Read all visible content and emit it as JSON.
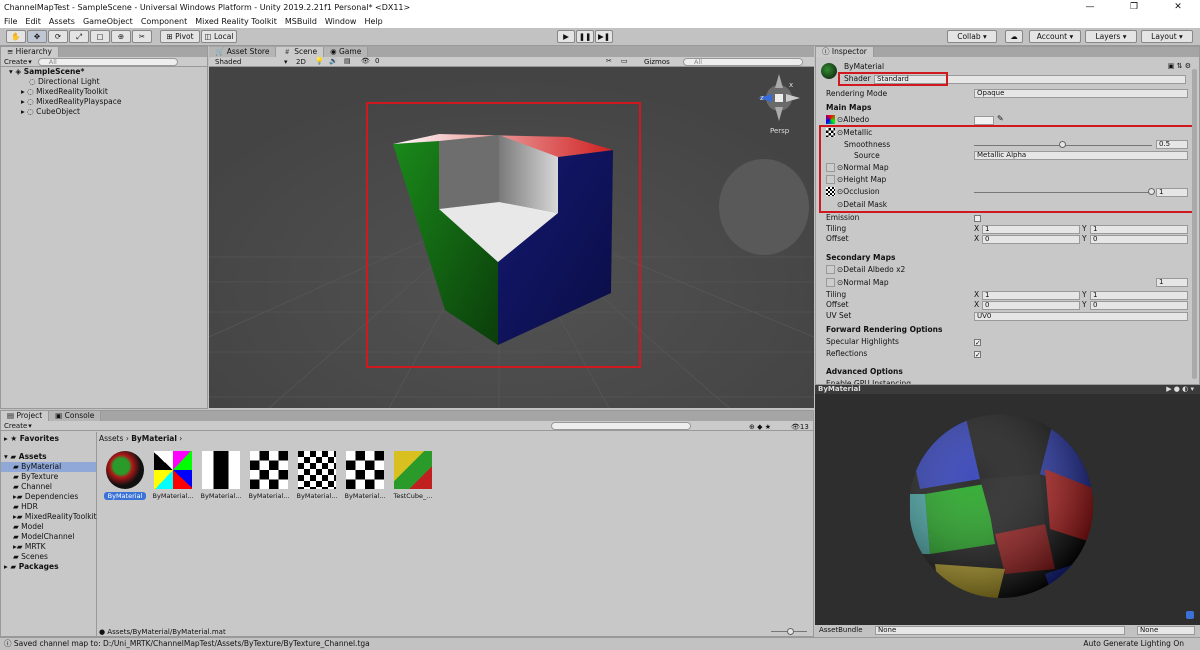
{
  "window": {
    "title": "ChannelMapTest - SampleScene - Universal Windows Platform - Unity 2019.2.21f1 Personal* <DX11>"
  },
  "menu": [
    "File",
    "Edit",
    "Assets",
    "GameObject",
    "Component",
    "Mixed Reality Toolkit",
    "MSBuild",
    "Window",
    "Help"
  ],
  "toolbar": {
    "pivot": "Pivot",
    "local": "Local",
    "collab": "Collab",
    "account": "Account",
    "layers": "Layers",
    "layout": "Layout"
  },
  "hierarchy": {
    "tab": "Hierarchy",
    "create": "Create",
    "search_placeholder": "All",
    "scene": "SampleScene*",
    "items": [
      "Directional Light",
      "MixedRealityToolkit",
      "MixedRealityPlayspace",
      "CubeObject"
    ]
  },
  "scene_view": {
    "tabs": [
      "Asset Store",
      "Scene",
      "Game"
    ],
    "shading": "Shaded",
    "mode2d": "2D",
    "gizmos": "Gizmos",
    "search_placeholder": "All",
    "persp": "Persp",
    "axis_x": "x",
    "axis_z": "z",
    "visible_count": "0"
  },
  "inspector": {
    "tab": "Inspector",
    "material_name": "ByMaterial",
    "shader_label": "Shader",
    "shader_value": "Standard",
    "rendering_mode_label": "Rendering Mode",
    "rendering_mode_value": "Opaque",
    "main_maps": "Main Maps",
    "albedo": "Albedo",
    "metallic": "Metallic",
    "smoothness": "Smoothness",
    "smoothness_value": "0.5",
    "smoothness_level": 0.5,
    "source": "Source",
    "source_value": "Metallic Alpha",
    "normal_map": "Normal Map",
    "height_map": "Height Map",
    "occlusion": "Occlusion",
    "occlusion_value": "1",
    "occlusion_level": 1.0,
    "detail_mask": "Detail Mask",
    "emission": "Emission",
    "tiling": "Tiling",
    "offset": "Offset",
    "tiling_x": "1",
    "tiling_y": "1",
    "offset_x": "0",
    "offset_y": "0",
    "secondary_maps": "Secondary Maps",
    "detail_albedo": "Detail Albedo x2",
    "normal_map2": "Normal Map",
    "normal_map2_value": "1",
    "tiling2_x": "1",
    "tiling2_y": "1",
    "offset2_x": "0",
    "offset2_y": "0",
    "uv_set": "UV Set",
    "uv_set_value": "UV0",
    "forward_options": "Forward Rendering Options",
    "specular_highlights": "Specular Highlights",
    "reflections": "Reflections",
    "advanced_options": "Advanced Options",
    "gpu_instancing": "Enable GPU Instancing",
    "axis_x": "X",
    "axis_y": "Y"
  },
  "preview": {
    "title": "ByMaterial",
    "asset_bundle_label": "AssetBundle",
    "asset_bundle_value": "None",
    "variant_value": "None"
  },
  "project": {
    "tabs": [
      "Project",
      "Console"
    ],
    "create": "Create",
    "favorites": "Favorites",
    "assets": "Assets",
    "folders": [
      "ByMaterial",
      "ByTexture",
      "Channel",
      "Dependencies",
      "HDR",
      "MixedRealityToolkit",
      "Model",
      "ModelChannel",
      "MRTK",
      "Scenes"
    ],
    "packages": "Packages",
    "breadcrumb": [
      "Assets",
      "ByMaterial"
    ],
    "count": "13",
    "asset_items": [
      "ByMaterial",
      "ByMaterial...",
      "ByMaterial...",
      "ByMaterial...",
      "ByMaterial...",
      "ByMaterial...",
      "TestCube_..."
    ],
    "selected_path": "Assets/ByMaterial/ByMaterial.mat"
  },
  "status": {
    "message": "Saved channel map to: D:/Uni_MRTK/ChannelMapTest/Assets/ByTexture/ByTexture_Channel.tga",
    "right": "Auto Generate Lighting On"
  },
  "colors": {
    "highlight": "#d01820",
    "selection": "#3a72d8"
  }
}
